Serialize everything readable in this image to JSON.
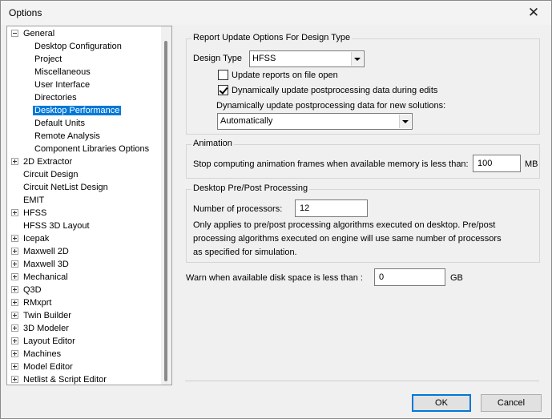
{
  "window": {
    "title": "Options"
  },
  "tree": {
    "items": [
      {
        "label": "General",
        "level": 0,
        "expander": "minus"
      },
      {
        "label": "Desktop Configuration",
        "level": 1
      },
      {
        "label": "Project",
        "level": 1
      },
      {
        "label": "Miscellaneous",
        "level": 1
      },
      {
        "label": "User Interface",
        "level": 1
      },
      {
        "label": "Directories",
        "level": 1
      },
      {
        "label": "Desktop Performance",
        "level": 1,
        "selected": true
      },
      {
        "label": "Default Units",
        "level": 1
      },
      {
        "label": "Remote Analysis",
        "level": 1
      },
      {
        "label": "Component Libraries Options",
        "level": 1
      },
      {
        "label": "2D Extractor",
        "level": 0,
        "expander": "plus"
      },
      {
        "label": "Circuit Design",
        "level": 0
      },
      {
        "label": "Circuit NetList Design",
        "level": 0
      },
      {
        "label": "EMIT",
        "level": 0
      },
      {
        "label": "HFSS",
        "level": 0,
        "expander": "plus"
      },
      {
        "label": "HFSS 3D Layout",
        "level": 0
      },
      {
        "label": "Icepak",
        "level": 0,
        "expander": "plus"
      },
      {
        "label": "Maxwell 2D",
        "level": 0,
        "expander": "plus"
      },
      {
        "label": "Maxwell 3D",
        "level": 0,
        "expander": "plus"
      },
      {
        "label": "Mechanical",
        "level": 0,
        "expander": "plus"
      },
      {
        "label": "Q3D",
        "level": 0,
        "expander": "plus"
      },
      {
        "label": "RMxprt",
        "level": 0,
        "expander": "plus"
      },
      {
        "label": "Twin Builder",
        "level": 0,
        "expander": "plus"
      },
      {
        "label": "3D Modeler",
        "level": 0,
        "expander": "plus"
      },
      {
        "label": "Layout Editor",
        "level": 0,
        "expander": "plus"
      },
      {
        "label": "Machines",
        "level": 0,
        "expander": "plus"
      },
      {
        "label": "Model Editor",
        "level": 0,
        "expander": "plus"
      },
      {
        "label": "Netlist & Script Editor",
        "level": 0,
        "expander": "plus"
      }
    ]
  },
  "report": {
    "group_title": "Report Update Options For Design Type",
    "design_type_label": "Design Type",
    "design_type_value": "HFSS",
    "update_on_open_label": "Update reports on file open",
    "update_on_open_checked": false,
    "dynamic_update_label": "Dynamically update postprocessing data during edits",
    "dynamic_update_checked": true,
    "new_solutions_label": "Dynamically update postprocessing data for new solutions:",
    "new_solutions_value": "Automatically"
  },
  "animation": {
    "group_title": "Animation",
    "stop_label": "Stop computing animation frames when available memory is less than:",
    "memory_value": "100",
    "memory_unit": "MB"
  },
  "prepost": {
    "group_title": "Desktop Pre/Post Processing",
    "processors_label": "Number of processors:",
    "processors_value": "12",
    "note_line1": "Only applies to pre/post processing algorithms executed on desktop. Pre/post",
    "note_line2": "processing algorithms executed on engine will use same number of processors",
    "note_line3": "as specified for simulation."
  },
  "disk": {
    "warn_label": "Warn when available disk space is less than :",
    "value": "0",
    "unit": "GB"
  },
  "buttons": {
    "ok": "OK",
    "cancel": "Cancel"
  }
}
